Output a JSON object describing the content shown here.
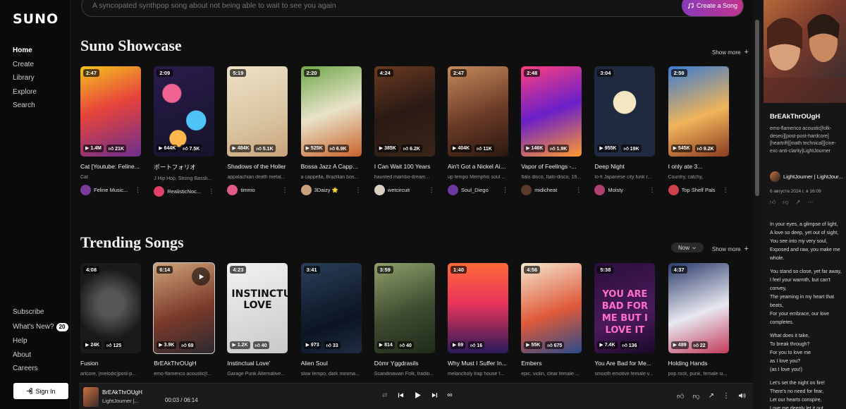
{
  "logo": "SUNO",
  "nav": [
    "Home",
    "Create",
    "Library",
    "Explore",
    "Search"
  ],
  "footer_nav": {
    "subscribe": "Subscribe",
    "whats_new": "What's New?",
    "whats_new_count": "20",
    "help": "Help",
    "about": "About",
    "careers": "Careers"
  },
  "signin_label": "Sign In",
  "prompt": {
    "placeholder": "A syncopated synthpop song about not being able to wait to see you again",
    "create_label": "Create a Song"
  },
  "showcase": {
    "title": "Suno Showcase",
    "show_more": "Show more",
    "cards": [
      {
        "duration": "2:47",
        "plays": "1.4M",
        "likes": "21K",
        "title": "Cat [Youtube: Feline...",
        "style": "Cat",
        "artist": "Feline Music..."
      },
      {
        "duration": "2:09",
        "plays": "644K",
        "likes": "7.5K",
        "title": "ポートフォリオ",
        "style": "J Hip Hop, Strong Bassli...",
        "artist": "RealisticNoc..."
      },
      {
        "duration": "5:19",
        "plays": "484K",
        "likes": "5.1K",
        "title": "Shadows of the Holler",
        "style": "appalachian death metal...",
        "artist": "timmo"
      },
      {
        "duration": "2:20",
        "plays": "525K",
        "likes": "6.9K",
        "title": "Bossa Jazz A Cappella",
        "style": "a cappella, Brazilian bos...",
        "artist": "3Daizy 🌟"
      },
      {
        "duration": "4:24",
        "plays": "385K",
        "likes": "6.2K",
        "title": "I Can Wait 100 Years",
        "style": "haunted mambo-dream...",
        "artist": "wetcircuit"
      },
      {
        "duration": "2:47",
        "plays": "404K",
        "likes": "11K",
        "title": "Ain't Got a Nickel Ain't...",
        "style": "up tempo Memphis soul ...",
        "artist": "Soul_Diego"
      },
      {
        "duration": "2:48",
        "plays": "146K",
        "likes": "1.9K",
        "title": "Vapor of Feelings -...",
        "style": "Italo disco, Italo-disco, 19...",
        "artist": "midicheat"
      },
      {
        "duration": "3:04",
        "plays": "955K",
        "likes": "19K",
        "title": "Deep Night",
        "style": "lo-fi Japanese city funk r...",
        "artist": "Moisty"
      },
      {
        "duration": "2:59",
        "plays": "545K",
        "likes": "9.2K",
        "title": "I only ate 3...",
        "style": "Country, catchy,",
        "artist": "Top Shelf Pals"
      }
    ]
  },
  "trending": {
    "title": "Trending Songs",
    "filter": "Now",
    "show_more": "Show more",
    "cards": [
      {
        "duration": "4:08",
        "plays": "24K",
        "likes": "125",
        "title": "Fusion",
        "style": "artcore, [melodic]post-p..."
      },
      {
        "duration": "6:14",
        "plays": "3.9K",
        "likes": "69",
        "title": "BrEAkThrOUgH",
        "style": "emo-flamenco acoustic[f..."
      },
      {
        "duration": "4:23",
        "plays": "1.2K",
        "likes": "40",
        "title": "Instinctual Love'",
        "style": "Garage Punk Alternative...",
        "art_text": "INSTINCTUAL LOVE"
      },
      {
        "duration": "3:41",
        "plays": "973",
        "likes": "33",
        "title": "Alien Soul",
        "style": "slow tempo, dark minima..."
      },
      {
        "duration": "3:59",
        "plays": "814",
        "likes": "40",
        "title": "Dómr Yggdrasils",
        "style": "Scandinavian Folk, traditi..."
      },
      {
        "duration": "1:40",
        "plays": "69",
        "likes": "16",
        "title": "Why Must I Suffer In...",
        "style": "melancholy trap house f..."
      },
      {
        "duration": "4:56",
        "plays": "55K",
        "likes": "675",
        "title": "Embers",
        "style": "epic, violin, clear female ..."
      },
      {
        "duration": "5:38",
        "plays": "7.4K",
        "likes": "136",
        "title": "You Are Bad for Me...",
        "style": "smooth emotive female v...",
        "art_text": "YOU ARE BAD FOR ME BUT I LOVE IT"
      },
      {
        "duration": "4:37",
        "plays": "489",
        "likes": "22",
        "title": "Holding Hands",
        "style": "pop rock, punk, female si..."
      }
    ]
  },
  "player": {
    "title": "BrEAkThrOUgH",
    "artist": "LightJourner |...",
    "time": "00:03 / 06:14"
  },
  "panel": {
    "title": "BrEAkThrOUgH",
    "style": "emo-flamenco acoustic[folk-deseo][post-post-hardcore][heartrift][math technical][cine-exc-anti-clarity]LightJourner",
    "artist": "LightJourner | LightJour...",
    "date": "6 августа 2024 г. в 16:09",
    "lyrics": [
      "In your eyes, a glimpse of light,\nA love so deep, yet out of sight,\nYou see into my very soul,\nExposed and raw, you make me whole.",
      "You stand so close, yet far away,\nI feel your warmth, but can't convey,\nThe yearning in my heart that beats,\nFor your embrace, our love completes.",
      "What does it take,\nTo break through?\nFor you to love me\nas I love you?\n(as I love you!)",
      "Let's set the night on fire!\nThere's no need for fear,\nLet our hearts conspire,\nLove me deeply let it out"
    ]
  },
  "colors": {
    "accent_start": "#8a3ab9",
    "accent_end": "#c2348f",
    "background": "#0f0f10"
  }
}
